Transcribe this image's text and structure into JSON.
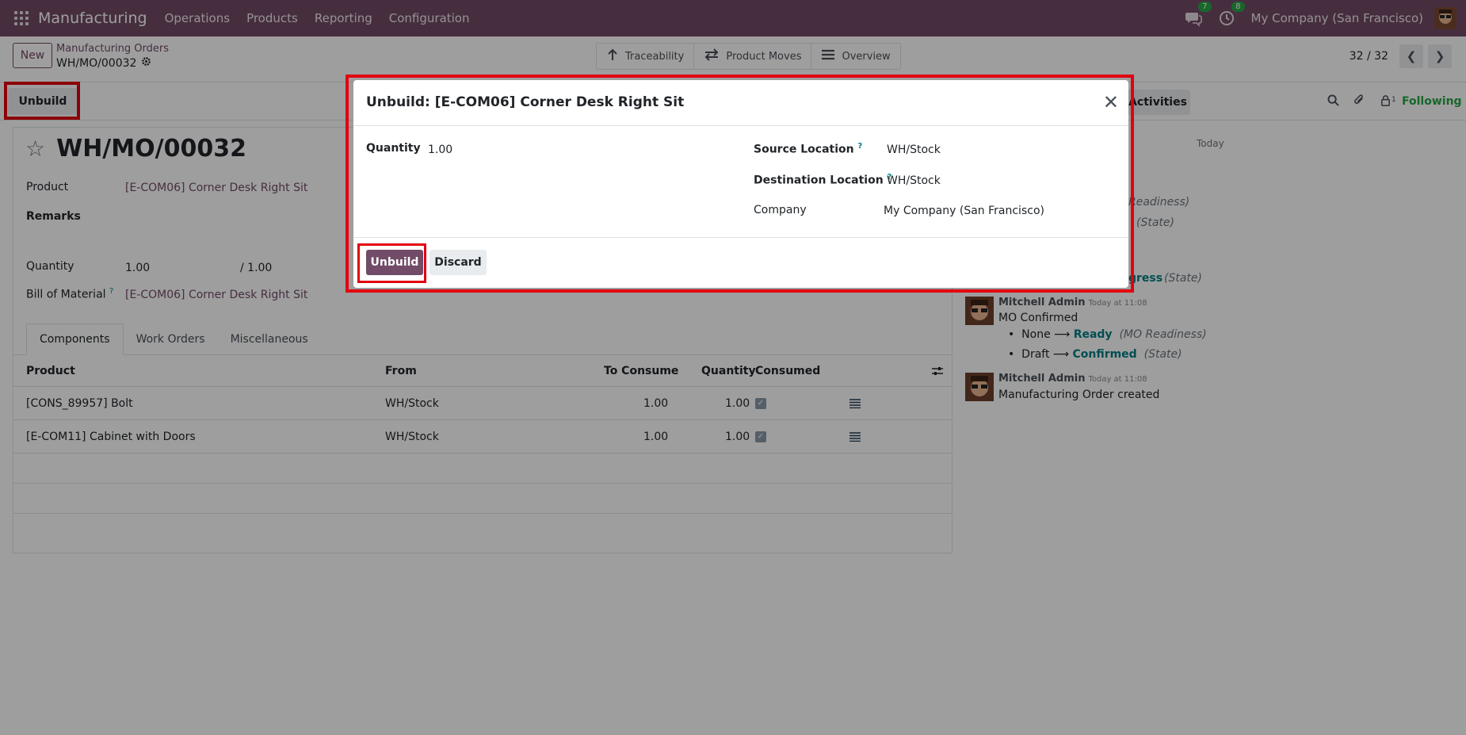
{
  "navbar": {
    "app_name": "Manufacturing",
    "menu": [
      "Operations",
      "Products",
      "Reporting",
      "Configuration"
    ],
    "messages_count": "7",
    "activities_count": "8",
    "company": "My Company (San Francisco)",
    "color": "#714B67"
  },
  "control": {
    "new_label": "New",
    "breadcrumb_parent": "Manufacturing Orders",
    "breadcrumb_current": "WH/MO/00032",
    "smart_buttons": [
      "Traceability",
      "Product Moves",
      "Overview"
    ],
    "pager": "32 / 32"
  },
  "statusbar": {
    "unbuild_label": "Unbuild"
  },
  "chatter": {
    "activities_label": "Activities",
    "followers_count": "1",
    "following_label": "Following",
    "today_label": "Today",
    "partial_lines": [
      "Readiness)",
      "(State)",
      "gress",
      "(State)"
    ],
    "messages": [
      {
        "author": "Mitchell Admin",
        "time": "Today at 11:08",
        "text": "MO Confirmed",
        "changes": [
          {
            "from": "None",
            "to": "Ready",
            "field": "(MO Readiness)"
          },
          {
            "from": "Draft",
            "to": "Confirmed",
            "field": "(State)"
          }
        ]
      },
      {
        "author": "Mitchell Admin",
        "time": "Today at 11:08",
        "text": "Manufacturing Order created"
      }
    ]
  },
  "form": {
    "title": "WH/MO/00032",
    "product_label": "Product",
    "product_value": "[E-COM06] Corner Desk Right Sit",
    "remarks_label": "Remarks",
    "quantity_label": "Quantity",
    "quantity_value": "1.00",
    "quantity_total": "/ 1.00",
    "bom_label": "Bill of Material",
    "bom_help": "?",
    "bom_value": "[E-COM06] Corner Desk Right Sit",
    "tabs": [
      "Components",
      "Work Orders",
      "Miscellaneous"
    ],
    "columns": [
      "Product",
      "From",
      "To Consume",
      "Quantity",
      "Consumed"
    ],
    "rows": [
      {
        "product": "[CONS_89957] Bolt",
        "from": "WH/Stock",
        "to_consume": "1.00",
        "quantity": "1.00"
      },
      {
        "product": "[E-COM11] Cabinet with Doors",
        "from": "WH/Stock",
        "to_consume": "1.00",
        "quantity": "1.00"
      }
    ]
  },
  "modal": {
    "title": "Unbuild: [E-COM06] Corner Desk Right Sit",
    "quantity_label": "Quantity",
    "quantity_value": "1.00",
    "source_label": "Source Location",
    "source_value": "WH/Stock",
    "dest_label": "Destination Location",
    "dest_value": "WH/Stock",
    "help_mark": "?",
    "company_label": "Company",
    "company_value": "My Company (San Francisco)",
    "confirm_label": "Unbuild",
    "discard_label": "Discard"
  }
}
